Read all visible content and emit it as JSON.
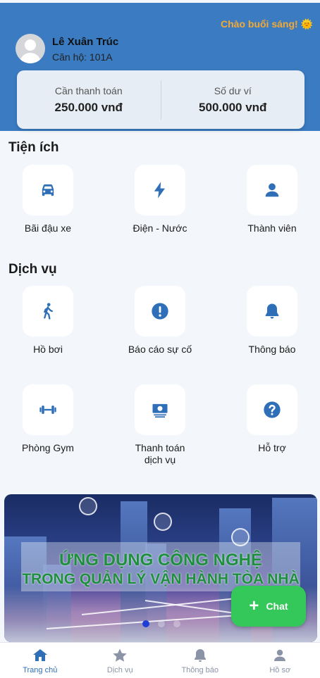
{
  "header": {
    "greeting": "Chào buổi sáng! 🌞",
    "user_name": "Lê Xuân Trúc",
    "apartment": "Căn hộ: 101A"
  },
  "balance": {
    "due_label": "Cần thanh toán",
    "due_value": "250.000 vnđ",
    "wallet_label": "Số dư ví",
    "wallet_value": "500.000 vnđ"
  },
  "utilities": {
    "title": "Tiện ích",
    "items": [
      {
        "label": "Bãi đậu xe",
        "icon": "car-icon"
      },
      {
        "label": "Điện - Nước",
        "icon": "lightning-icon"
      },
      {
        "label": "Thành viên",
        "icon": "person-icon"
      }
    ]
  },
  "services": {
    "title": "Dịch vụ",
    "items": [
      {
        "label": "Hồ bơi",
        "icon": "walking-person-icon"
      },
      {
        "label": "Báo cáo sự cố",
        "icon": "exclamation-icon"
      },
      {
        "label": "Thông báo",
        "icon": "bell-icon"
      },
      {
        "label": "Phòng Gym",
        "icon": "dumbbell-icon"
      },
      {
        "label": "Thanh toán dịch vụ",
        "icon": "money-icon"
      },
      {
        "label": "Hỗ trợ",
        "icon": "question-icon"
      }
    ]
  },
  "banner": {
    "line1": "ỨNG DỤNG CÔNG NGHỆ",
    "line2": "TRONG QUẢN LÝ VẬN HÀNH TÒA NHÀ",
    "slide_count": 3,
    "active_slide": 1
  },
  "chat": {
    "label": "Chat"
  },
  "tabbar": {
    "items": [
      {
        "label": "Trang chủ",
        "icon": "home-icon",
        "active": true
      },
      {
        "label": "Dịch vụ",
        "icon": "star-icon",
        "active": false
      },
      {
        "label": "Thông báo",
        "icon": "bell-icon",
        "active": false
      },
      {
        "label": "Hồ sơ",
        "icon": "person-icon",
        "active": false
      }
    ]
  },
  "colors": {
    "primary": "#3a7bc1",
    "icon": "#2f6fb8",
    "greeting": "#f4a934",
    "banner_text": "#1e8f3e",
    "chat": "#34c759",
    "tab_inactive": "#8a94a6"
  }
}
